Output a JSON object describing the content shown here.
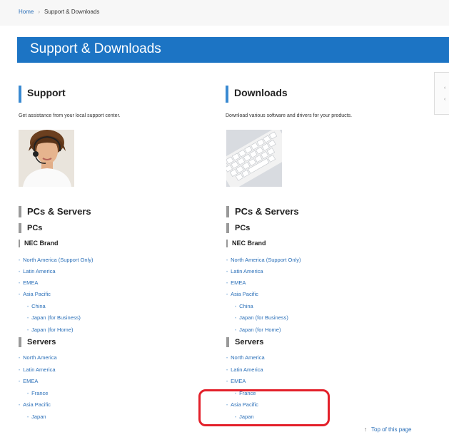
{
  "breadcrumb": {
    "home": "Home",
    "separator": "›",
    "current": "Support & Downloads"
  },
  "banner": {
    "title": "Support & Downloads"
  },
  "support": {
    "title": "Support",
    "description": "Get assistance from your local support center.",
    "image_icon": "support-agent-photo"
  },
  "downloads": {
    "title": "Downloads",
    "description": "Download various software and drivers for your products.",
    "image_icon": "keyboard-photo"
  },
  "left": {
    "heading": "PCs & Servers",
    "pcs": "PCs",
    "brand": "NEC Brand",
    "pc_links": [
      "North America (Support Only)",
      "Latin America",
      "EMEA",
      "Asia Pacific"
    ],
    "pc_sublinks": [
      "China",
      "Japan (for Business)",
      "Japan (for Home)"
    ],
    "servers": "Servers",
    "server_links": [
      "North America",
      "Latin America",
      "EMEA"
    ],
    "server_sub_emea": "France",
    "server_asia": "Asia Pacific",
    "server_sub_asia": "Japan"
  },
  "right": {
    "heading": "PCs & Servers",
    "pcs": "PCs",
    "brand": "NEC Brand",
    "pc_links": [
      "North America (Support Only)",
      "Latin America",
      "EMEA",
      "Asia Pacific"
    ],
    "pc_sublinks": [
      "China",
      "Japan (for Business)",
      "Japan (for Home)"
    ],
    "servers": "Servers",
    "server_links": [
      "North America",
      "Latin America",
      "EMEA"
    ],
    "server_sub_emea": "France",
    "server_asia": "Asia Pacific",
    "server_sub_asia": "Japan"
  },
  "side_tab": {
    "up": "‹",
    "down": "‹"
  },
  "footer": {
    "top_of_page": "Top of this page",
    "arrow_icon": "up-arrow-icon"
  },
  "colors": {
    "accent": "#1c74c4",
    "link": "#2a6fb8",
    "highlight": "#e3202a"
  }
}
